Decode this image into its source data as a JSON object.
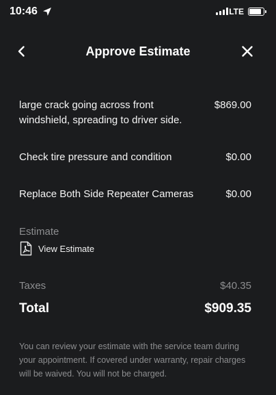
{
  "status_bar": {
    "time": "10:46",
    "network": "LTE",
    "signal_bars": 4,
    "battery_level": 0.85
  },
  "header": {
    "title": "Approve Estimate",
    "back_icon": "chevron-left-icon",
    "close_icon": "close-icon"
  },
  "line_items": [
    {
      "description": "large crack going across front windshield, spreading to driver side.",
      "price": "$869.00"
    },
    {
      "description": "Check tire pressure and condition",
      "price": "$0.00"
    },
    {
      "description": "Replace Both Side Repeater Cameras",
      "price": "$0.00"
    }
  ],
  "estimate": {
    "label": "Estimate",
    "link_label": "View Estimate",
    "icon": "pdf-document-icon"
  },
  "summary": {
    "taxes_label": "Taxes",
    "taxes_value": "$40.35",
    "total_label": "Total",
    "total_value": "$909.35"
  },
  "disclaimer": "You can review your estimate with the service team during your appointment. If covered under warranty, repair charges will be waived. You will not be charged.",
  "colors": {
    "background": "#1b1c1e",
    "primary_text": "#ffffff",
    "secondary_text": "#8d8e90"
  }
}
